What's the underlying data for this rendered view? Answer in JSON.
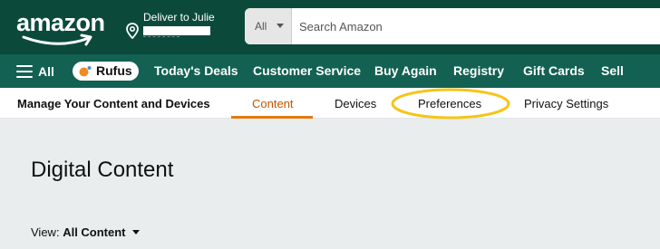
{
  "header": {
    "logo_text": "amazon",
    "deliver_label": "Deliver to Julie",
    "search": {
      "category": "All",
      "placeholder": "Search Amazon"
    }
  },
  "nav": {
    "all_label": "All",
    "rufus_label": "Rufus",
    "links": [
      "Today's Deals",
      "Customer Service",
      "Buy Again",
      "Registry",
      "Gift Cards",
      "Sell"
    ]
  },
  "subnav": {
    "title": "Manage Your Content and Devices",
    "tabs": [
      "Content",
      "Devices",
      "Preferences",
      "Privacy Settings"
    ],
    "active_tab": "Content",
    "highlighted_tab": "Preferences"
  },
  "main": {
    "title": "Digital Content",
    "view_label": "View:",
    "view_value": "All Content"
  },
  "colors": {
    "header_bg": "#0b4a3b",
    "nav_bg": "#136152",
    "active_tab": "#c45500",
    "tab_underline": "#e47911",
    "highlight": "#f5c518",
    "smile": "#ff9900"
  }
}
